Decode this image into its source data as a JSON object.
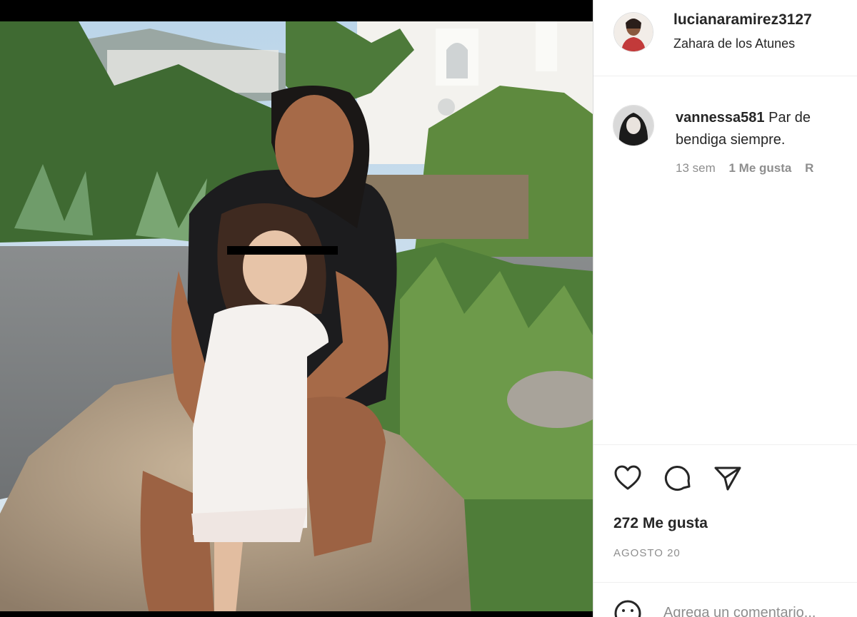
{
  "post": {
    "author": {
      "username": "lucianaramirez3127",
      "location": "Zahara de los Atunes"
    },
    "comment": {
      "username": "vannessa581",
      "text_line1": "Par de",
      "text_line2": "bendiga siempre.",
      "time": "13 sem",
      "likes": "1 Me gusta",
      "reply": "R"
    },
    "actions": {
      "like_icon": "heart-icon",
      "comment_icon": "comment-bubble-icon",
      "share_icon": "paper-plane-icon"
    },
    "likes_count": "272 Me gusta",
    "date": "AGOSTO 20",
    "add_comment_placeholder": "Agrega un comentario..."
  },
  "colors": {
    "text": "#262626",
    "muted": "#8e8e8e",
    "divider": "#efefef"
  }
}
